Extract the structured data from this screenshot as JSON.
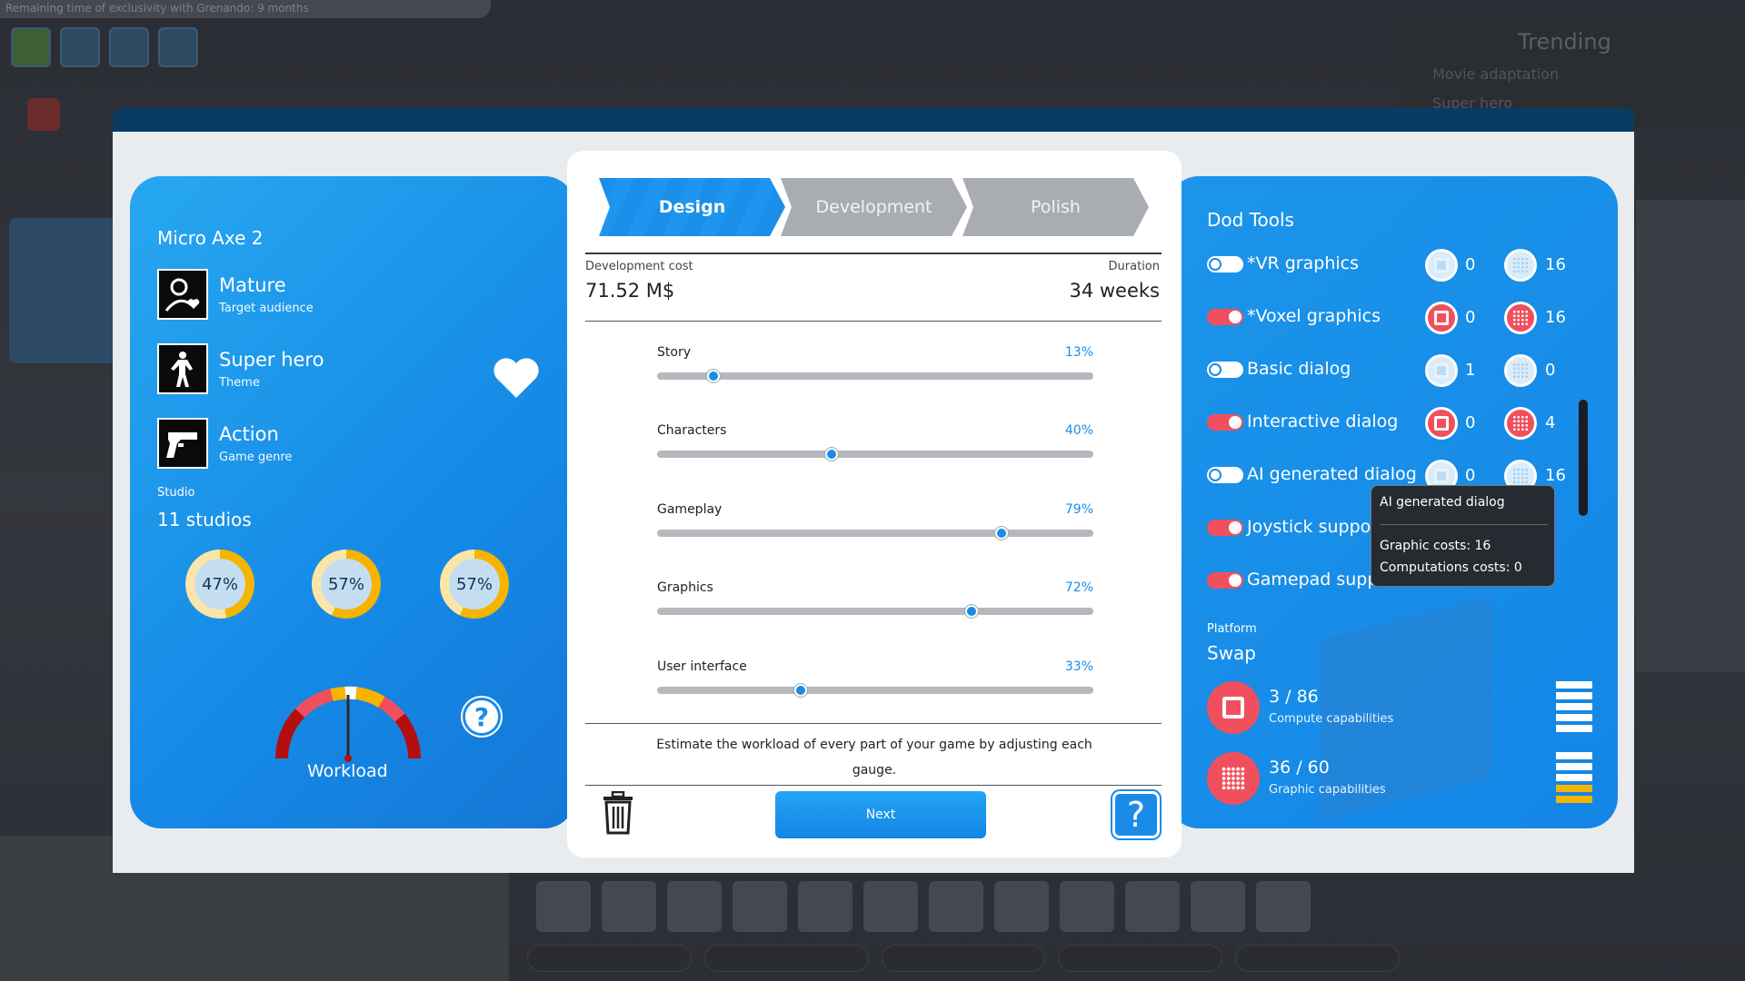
{
  "background": {
    "notice": "Remaining time of exclusivity with Grenando: 9 months",
    "trending_title": "Trending",
    "trending_items": [
      "Movie adaptation",
      "Super hero"
    ]
  },
  "game": {
    "title": "Micro Axe 2",
    "audience": {
      "value": "Mature",
      "label": "Target audience",
      "icon": "mature-audience-icon"
    },
    "theme": {
      "value": "Super hero",
      "label": "Theme",
      "icon": "super-hero-icon"
    },
    "genre": {
      "value": "Action",
      "label": "Game genre",
      "icon": "pistol-icon"
    },
    "studio_label": "Studio",
    "studio_value": "11 studios",
    "studio_rings": [
      {
        "label": "47%",
        "value": 0.47
      },
      {
        "label": "57%",
        "value": 0.57
      },
      {
        "label": "57%",
        "value": 0.57
      }
    ],
    "workload_label": "Workload",
    "workload_gauge_value": 0.5
  },
  "tabs": [
    "Design",
    "Development",
    "Polish"
  ],
  "active_tab": "Design",
  "dev_cost": {
    "label": "Development cost",
    "value": "71.52 M$"
  },
  "duration": {
    "label": "Duration",
    "value": "34 weeks"
  },
  "sliders": [
    {
      "name": "Story",
      "pct": "13%",
      "value": 0.13
    },
    {
      "name": "Characters",
      "pct": "40%",
      "value": 0.4
    },
    {
      "name": "Gameplay",
      "pct": "79%",
      "value": 0.79
    },
    {
      "name": "Graphics",
      "pct": "72%",
      "value": 0.72
    },
    {
      "name": "User interface",
      "pct": "33%",
      "value": 0.33
    }
  ],
  "estimate_text": "Estimate the workload of every part of your game by adjusting each gauge.",
  "next_label": "Next",
  "help_label": "?",
  "tools": {
    "title": "Dod Tools",
    "items": [
      {
        "name": "*VR graphics",
        "on": false,
        "compute": "0",
        "graphic": "16"
      },
      {
        "name": "*Voxel graphics",
        "on": true,
        "compute": "0",
        "graphic": "16"
      },
      {
        "name": "Basic dialog",
        "on": false,
        "compute": "1",
        "graphic": "0"
      },
      {
        "name": "Interactive dialog",
        "on": true,
        "compute": "0",
        "graphic": "4"
      },
      {
        "name": "AI generated dialog",
        "on": false,
        "compute": "0",
        "graphic": "16"
      },
      {
        "name": "Joystick suppo",
        "on": true,
        "compute": "",
        "graphic": ""
      },
      {
        "name": "Gamepad suppo",
        "on": true,
        "compute": "",
        "graphic": ""
      }
    ]
  },
  "tooltip": {
    "title": "AI generated dialog",
    "graphic": "Graphic costs: 16",
    "compute": "Computations costs: 0"
  },
  "platform": {
    "label": "Platform",
    "value": "Swap",
    "compute": {
      "value": "3 / 86",
      "label": "Compute capabilities"
    },
    "graphic": {
      "value": "36 / 60",
      "label": "Graphic capabilities"
    }
  },
  "colors": {
    "accent": "#1a8ce8",
    "active_toggle": "#f0505e",
    "warning": "#f4b400"
  }
}
